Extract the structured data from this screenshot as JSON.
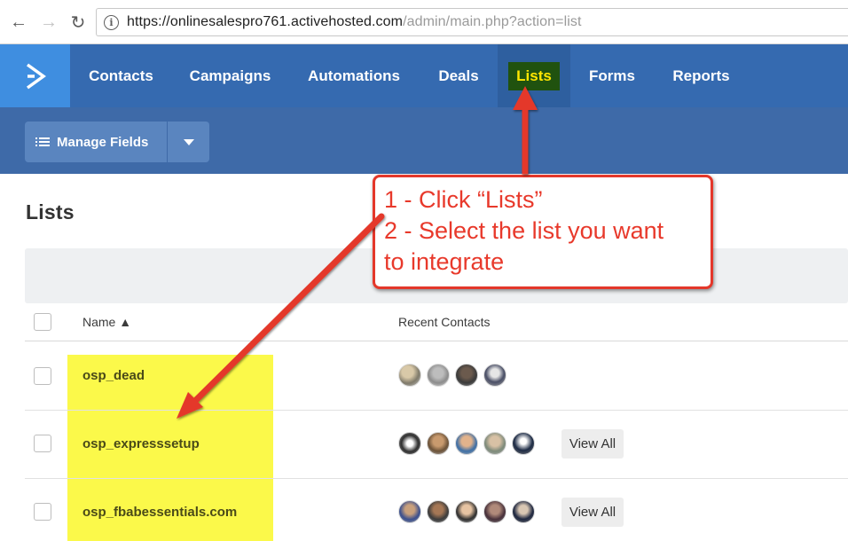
{
  "browser": {
    "url_domain": "https://onlinesalespro761.activehosted.com",
    "url_path": "/admin/main.php?action=list"
  },
  "nav": {
    "items": [
      {
        "label": "Contacts"
      },
      {
        "label": "Campaigns"
      },
      {
        "label": "Automations"
      },
      {
        "label": "Deals"
      },
      {
        "label": "Lists",
        "active": true
      },
      {
        "label": "Forms"
      },
      {
        "label": "Reports"
      }
    ]
  },
  "toolbar": {
    "manage_fields_label": "Manage Fields"
  },
  "page": {
    "title": "Lists"
  },
  "table": {
    "columns": [
      "Name ▲",
      "Recent Contacts"
    ],
    "rows": [
      {
        "name": "osp_dead",
        "view_all": ""
      },
      {
        "name": "osp_expresssetup",
        "view_all": "View All"
      },
      {
        "name": "osp_fbabessentials.com",
        "view_all": "View All"
      }
    ]
  },
  "annotation": {
    "line1": "1 - Click “Lists”",
    "line2": "2 - Select the list you want",
    "line3": "to integrate",
    "color": "#e4372a"
  },
  "colors": {
    "nav_bg": "#356ab0",
    "logo_bg": "#3f8ee0",
    "subbar_bg": "#3e6aa8",
    "highlight_yellow": "#fbf94a",
    "lists_tab_highlight": "#20520f"
  }
}
